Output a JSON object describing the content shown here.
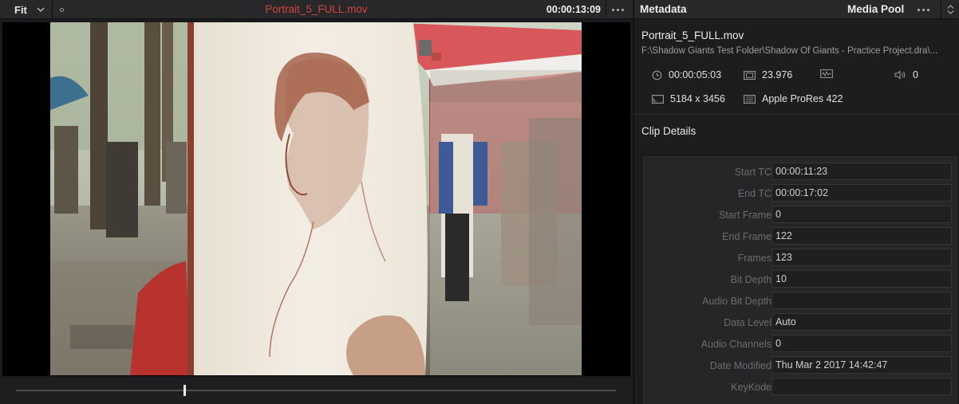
{
  "viewer": {
    "zoom": "Fit",
    "clip_title": "Portrait_5_FULL.mov",
    "timecode": "00:00:13:09",
    "scrubber_position": 0.279
  },
  "metadata_panel": {
    "tab_metadata": "Metadata",
    "tab_media_pool": "Media Pool",
    "clip_name": "Portrait_5_FULL.mov",
    "clip_path": "F:\\Shadow Giants Test Folder\\Shadow Of Giants - Practice Project.dra\\...",
    "duration": "00:00:05:03",
    "frame_rate": "23.976",
    "audio_channels": "0",
    "resolution": "5184 x 3456",
    "codec": "Apple ProRes 422",
    "section_title": "Clip Details",
    "details": [
      {
        "label": "Start TC",
        "value": "00:00:11:23"
      },
      {
        "label": "End TC",
        "value": "00:00:17:02"
      },
      {
        "label": "Start Frame",
        "value": "0"
      },
      {
        "label": "End Frame",
        "value": "122"
      },
      {
        "label": "Frames",
        "value": "123"
      },
      {
        "label": "Bit Depth",
        "value": "10"
      },
      {
        "label": "Audio Bit Depth",
        "value": ""
      },
      {
        "label": "Data Level",
        "value": "Auto"
      },
      {
        "label": "Audio Channels",
        "value": "0"
      },
      {
        "label": "Date Modified",
        "value": "Thu Mar 2 2017 14:42:47"
      },
      {
        "label": "KeyKode",
        "value": ""
      }
    ]
  },
  "colors": {
    "accent_title": "#d0463e",
    "panel_bg": "#1d1d1f",
    "header_bg": "#28282b"
  },
  "icons": [
    "chevron-down-icon",
    "dot-icon",
    "more-icon",
    "clock-icon",
    "film-icon",
    "waveform-icon",
    "speaker-icon",
    "resolution-icon",
    "codec-icon",
    "sort-icon"
  ]
}
